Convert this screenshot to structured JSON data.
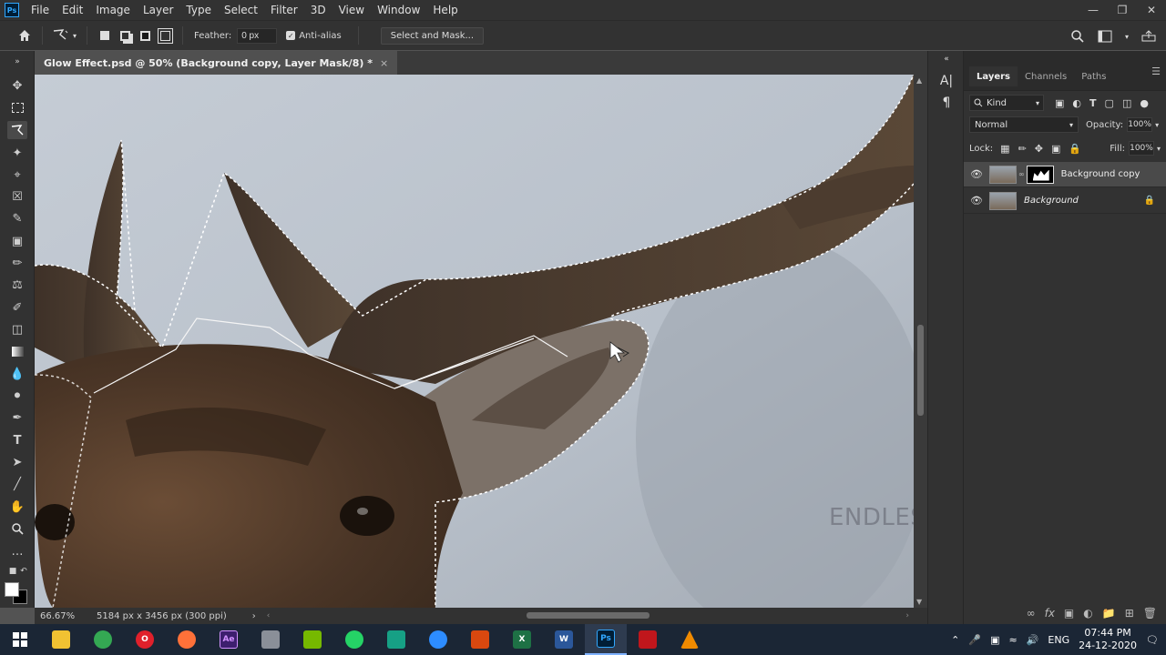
{
  "menu": {
    "app_badge": "Ps",
    "items": [
      "File",
      "Edit",
      "Image",
      "Layer",
      "Type",
      "Select",
      "Filter",
      "3D",
      "View",
      "Window",
      "Help"
    ]
  },
  "options": {
    "feather_label": "Feather:",
    "feather_value": "0 px",
    "antialias_label": "Anti-alias",
    "select_mask_label": "Select and Mask..."
  },
  "document": {
    "tab_title": "Glow Effect.psd @ 50% (Background copy, Layer Mask/8) *",
    "close_glyph": "×",
    "watermark": "ENDLESS KNOWLEDGE"
  },
  "status": {
    "zoom": "66.67%",
    "doc_info": "5184 px x 3456 px (300 ppi)"
  },
  "layers_panel": {
    "tabs": [
      "Layers",
      "Channels",
      "Paths"
    ],
    "kind_label": "Kind",
    "blend_mode": "Normal",
    "opacity_label": "Opacity:",
    "opacity_value": "100%",
    "lock_label": "Lock:",
    "fill_label": "Fill:",
    "fill_value": "100%",
    "layers": [
      {
        "name": "Background copy"
      },
      {
        "name": "Background"
      }
    ]
  },
  "taskbar": {
    "apps": [
      {
        "name": "file-explorer",
        "color": "#f1c232",
        "glyph": ""
      },
      {
        "name": "chrome",
        "color": "#34a853",
        "glyph": ""
      },
      {
        "name": "opera",
        "color": "#e0202b",
        "glyph": "O"
      },
      {
        "name": "firefox",
        "color": "#ff7139",
        "glyph": ""
      },
      {
        "name": "after-effects",
        "color": "#3d1f6e",
        "glyph": "Ae"
      },
      {
        "name": "settings-app",
        "color": "#8a8f98",
        "glyph": ""
      },
      {
        "name": "nvidia",
        "color": "#76b900",
        "glyph": ""
      },
      {
        "name": "whatsapp",
        "color": "#25d366",
        "glyph": ""
      },
      {
        "name": "app-green",
        "color": "#16a085",
        "glyph": ""
      },
      {
        "name": "zoom",
        "color": "#2d8cff",
        "glyph": ""
      },
      {
        "name": "app-red",
        "color": "#d9480f",
        "glyph": ""
      },
      {
        "name": "excel",
        "color": "#1e7145",
        "glyph": "X"
      },
      {
        "name": "word",
        "color": "#2b579a",
        "glyph": "W"
      },
      {
        "name": "photoshop",
        "color": "#001e36",
        "glyph": "Ps"
      },
      {
        "name": "acrobat",
        "color": "#c0161c",
        "glyph": ""
      },
      {
        "name": "vlc",
        "color": "#f08a00",
        "glyph": ""
      }
    ],
    "language": "ENG",
    "time": "07:44 PM",
    "date": "24-12-2020"
  }
}
